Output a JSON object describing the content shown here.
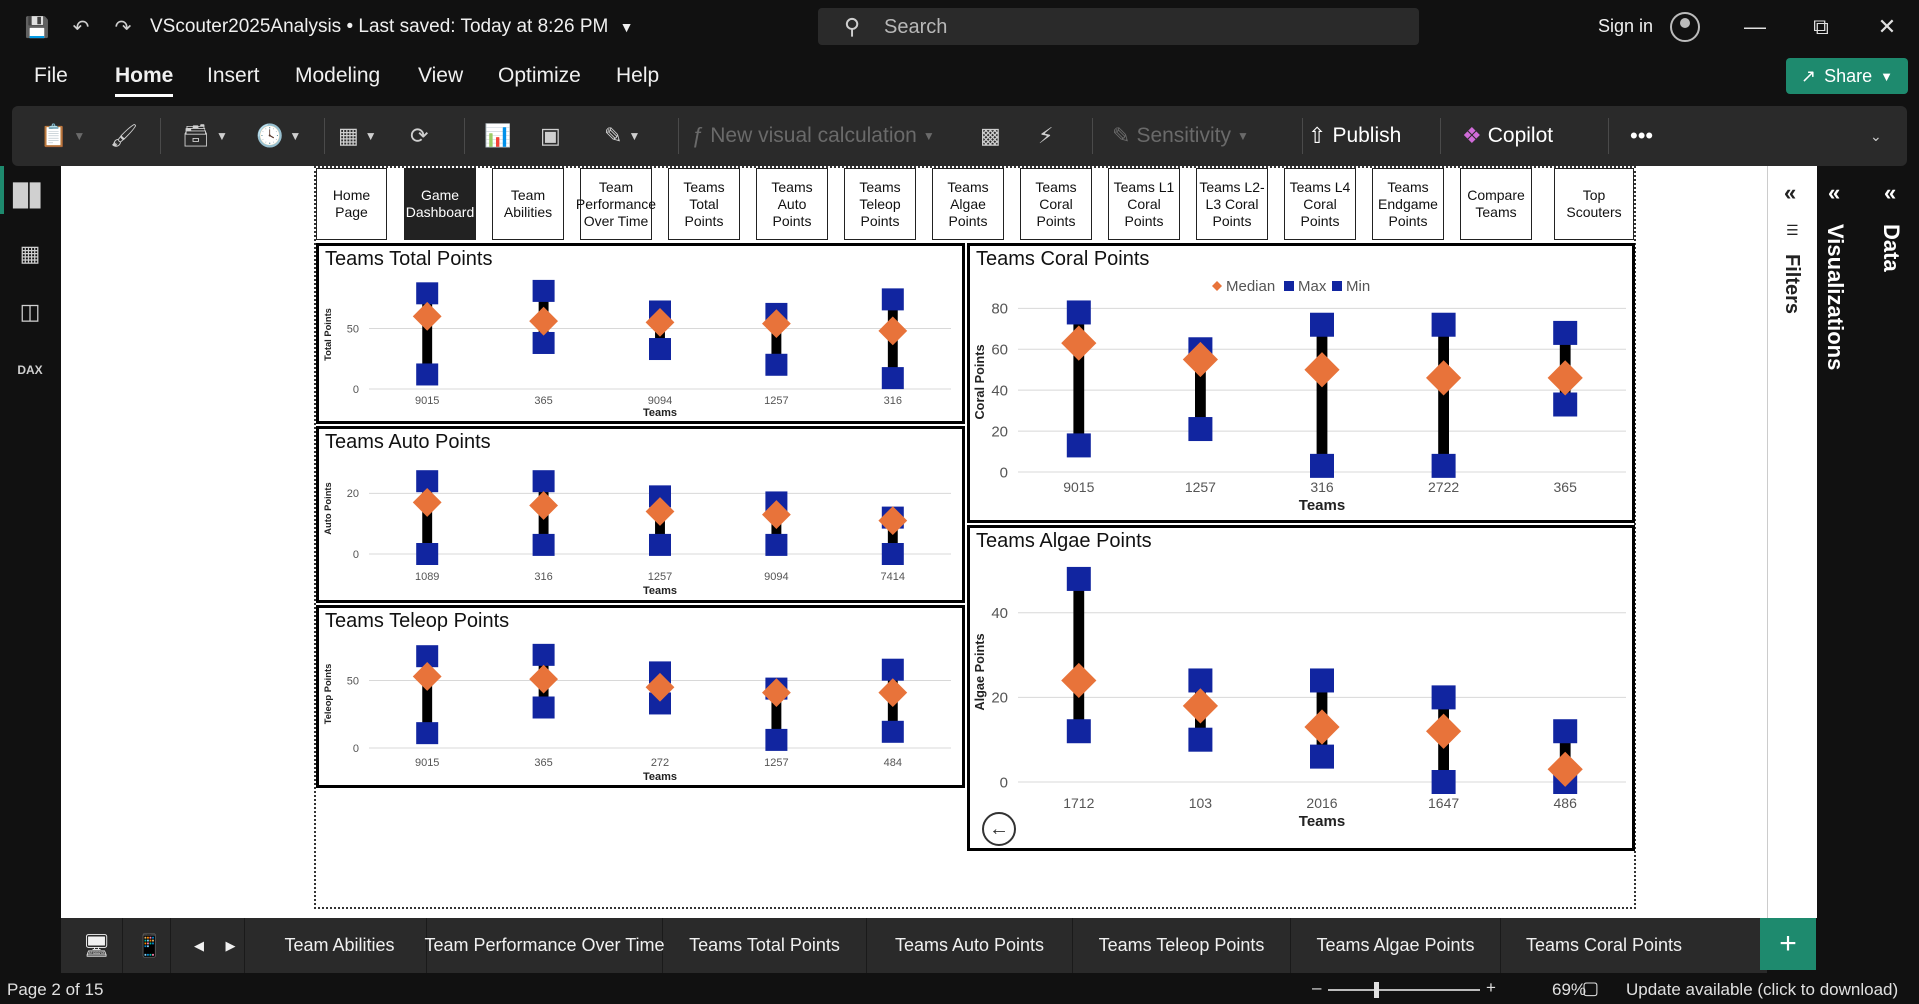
{
  "titlebar": {
    "doc_title": "VScouter2025Analysis • Last saved: Today at 8:26 PM",
    "search_placeholder": "Search",
    "sign_in": "Sign in"
  },
  "menu": {
    "items": [
      "File",
      "Home",
      "Insert",
      "Modeling",
      "View",
      "Optimize",
      "Help"
    ],
    "active": "Home",
    "share": "Share"
  },
  "ribbon": {
    "new_visual_calc": "New visual calculation",
    "sensitivity": "Sensitivity",
    "publish": "Publish",
    "copilot": "Copilot"
  },
  "report_nav": [
    "Home Page",
    "Game Dashboard",
    "Team Abilities",
    "Team Performance Over Time",
    "Teams Total Points",
    "Teams Auto Points",
    "Teams Teleop Points",
    "Teams Algae Points",
    "Teams Coral Points",
    "Teams L1 Coral Points",
    "Teams L2-L3 Coral Points",
    "Teams L4 Coral Points",
    "Teams Endgame Points",
    "Compare Teams",
    "Top Scouters"
  ],
  "report_nav_active": 1,
  "colors": {
    "median": "#e8733a",
    "max": "#1125a0",
    "min": "#1125a0",
    "range": "#000000",
    "accent": "#1e8a6e"
  },
  "chart_data": [
    {
      "id": "total",
      "type": "scatter",
      "title": "Teams Total Points",
      "xlabel": "Teams",
      "ylabel": "Total Points",
      "categories": [
        "9015",
        "365",
        "9094",
        "1257",
        "316"
      ],
      "ylim": [
        0,
        90
      ],
      "yticks": [
        0,
        50
      ],
      "series": [
        {
          "key": "max",
          "values": [
            79,
            81,
            64,
            62,
            74
          ]
        },
        {
          "key": "median",
          "values": [
            60,
            56,
            55,
            54,
            48
          ]
        },
        {
          "key": "min",
          "values": [
            12,
            38,
            33,
            20,
            9
          ]
        }
      ]
    },
    {
      "id": "auto",
      "type": "scatter",
      "title": "Teams Auto Points",
      "xlabel": "Teams",
      "ylabel": "Auto Points",
      "categories": [
        "1089",
        "316",
        "1257",
        "9094",
        "7414"
      ],
      "ylim": [
        0,
        30
      ],
      "yticks": [
        0,
        20
      ],
      "series": [
        {
          "key": "max",
          "values": [
            24,
            24,
            19,
            17,
            12
          ]
        },
        {
          "key": "median",
          "values": [
            17,
            16,
            14,
            13,
            11
          ]
        },
        {
          "key": "min",
          "values": [
            0,
            3,
            3,
            3,
            0
          ]
        }
      ]
    },
    {
      "id": "teleop",
      "type": "scatter",
      "title": "Teams Teleop Points",
      "xlabel": "Teams",
      "ylabel": "Teleop Points",
      "categories": [
        "9015",
        "365",
        "272",
        "1257",
        "484"
      ],
      "ylim": [
        0,
        80
      ],
      "yticks": [
        0,
        50
      ],
      "series": [
        {
          "key": "max",
          "values": [
            68,
            69,
            56,
            44,
            58
          ]
        },
        {
          "key": "median",
          "values": [
            53,
            51,
            45,
            41,
            41
          ]
        },
        {
          "key": "min",
          "values": [
            11,
            30,
            33,
            6,
            12
          ]
        }
      ]
    },
    {
      "id": "coral",
      "type": "scatter",
      "title": "Teams Coral Points",
      "xlabel": "Teams",
      "ylabel": "Coral Points",
      "categories": [
        "9015",
        "1257",
        "316",
        "2722",
        "365"
      ],
      "ylim": [
        0,
        88
      ],
      "yticks": [
        0,
        20,
        40,
        60,
        80
      ],
      "legend": [
        "Median",
        "Max",
        "Min"
      ],
      "legend_position": "top-center",
      "series": [
        {
          "key": "max",
          "values": [
            78,
            60,
            72,
            72,
            68
          ]
        },
        {
          "key": "median",
          "values": [
            63,
            55,
            50,
            46,
            46
          ]
        },
        {
          "key": "min",
          "values": [
            13,
            21,
            3,
            3,
            33
          ]
        }
      ]
    },
    {
      "id": "algae",
      "type": "scatter",
      "title": "Teams Algae Points",
      "xlabel": "Teams",
      "ylabel": "Algae Points",
      "categories": [
        "1712",
        "103",
        "2016",
        "1647",
        "486"
      ],
      "ylim": [
        0,
        52
      ],
      "yticks": [
        0,
        20,
        40
      ],
      "series": [
        {
          "key": "max",
          "values": [
            48,
            24,
            24,
            20,
            12
          ]
        },
        {
          "key": "median",
          "values": [
            24,
            18,
            13,
            12,
            3
          ]
        },
        {
          "key": "min",
          "values": [
            12,
            10,
            6,
            0,
            0
          ]
        }
      ]
    }
  ],
  "panes": {
    "filters": "Filters",
    "visualizations": "Visualizations",
    "data": "Data"
  },
  "page_tabs": [
    "Team Abilities",
    "Team Performance Over Time",
    "Teams Total Points",
    "Teams Auto Points",
    "Teams Teleop Points",
    "Teams Algae Points",
    "Teams Coral Points"
  ],
  "status": {
    "page": "Page 2 of 15",
    "zoom": "69%",
    "update": "Update available (click to download)"
  }
}
